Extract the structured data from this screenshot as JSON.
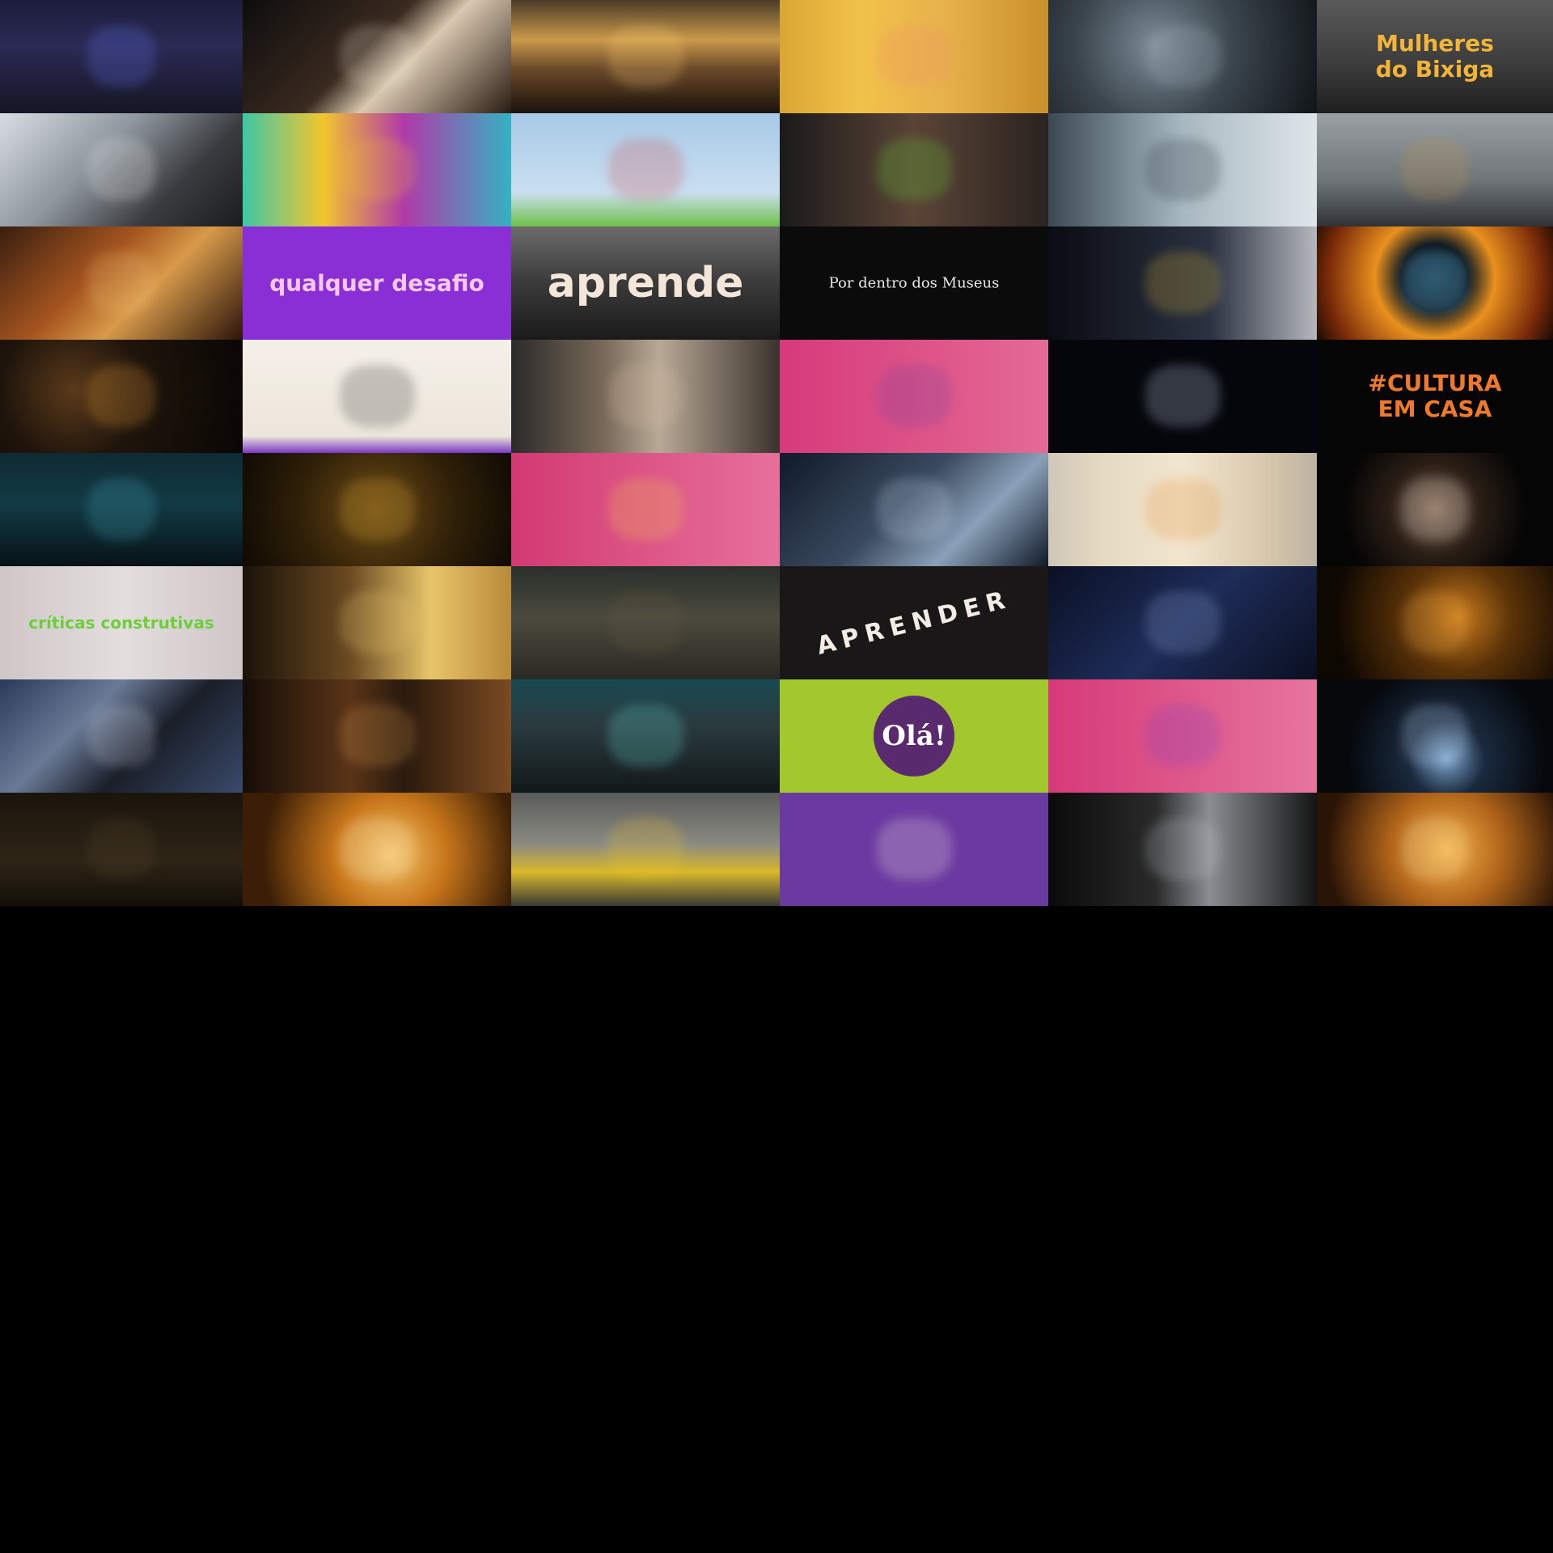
{
  "gallery": {
    "columns": [
      300,
      332,
      332,
      332,
      332,
      292
    ],
    "rows": [
      [
        {
          "id": "t1",
          "name": "thumb-conference-audience",
          "bg": "linear-gradient(180deg,#1b1d3a 0%,#2b2a55 40%,#151523 100%)",
          "accent": "#6b7cff",
          "caption": ""
        },
        {
          "id": "t2",
          "name": "thumb-orchestra-flute",
          "bg": "linear-gradient(135deg,#0d0d0d 0%,#3a2a20 45%,#d8c8b0 60%,#2a1b12 100%)",
          "accent": "#f0e6d6",
          "caption": ""
        },
        {
          "id": "t3",
          "name": "thumb-sunset-plane",
          "bg": "linear-gradient(180deg,#4a3a28 0%,#c99a4a 35%,#6d4a2a 60%,#1a130c 100%)",
          "accent": "#ffd27a",
          "caption": ""
        },
        {
          "id": "t4",
          "name": "thumb-yellow-alley-parade",
          "bg": "linear-gradient(90deg,#d9a634 0%,#f1c24a 30%,#e8b24c 60%,#c98f2a 100%)",
          "accent": "#f08a6a",
          "caption": ""
        },
        {
          "id": "t5",
          "name": "thumb-alien-face",
          "bg": "radial-gradient(circle at 40% 40%,#7c8b95 0%,#3b454d 45%,#101417 100%)",
          "accent": "#a8b6c0",
          "caption": ""
        },
        {
          "id": "t6",
          "name": "thumb-mulheres-do-bixiga",
          "bg": "linear-gradient(180deg,#5a5a5a 0%,#3a3a3a 60%,#1e1e1e 100%)",
          "accent": "#f2b53a",
          "caption": "Mulheres\ndo Bixiga"
        }
      ],
      [
        {
          "id": "t7",
          "name": "thumb-plane-cockpit-couple",
          "bg": "linear-gradient(135deg,#d8dde2 0%,#8e969d 40%,#3a3c40 70%,#1c1c1f 100%)",
          "accent": "#f2f2f2",
          "caption": ""
        },
        {
          "id": "t8",
          "name": "thumb-virada-online",
          "bg": "linear-gradient(90deg,#3ec7a6 0%,#f3c52d 30%,#b13aa8 60%,#34b2c3 100%)",
          "accent": "#f3c52d",
          "caption": ""
        },
        {
          "id": "t9",
          "name": "thumb-cartoon-barn",
          "bg": "linear-gradient(180deg,#a7c9e6 0%,#c9dff0 70%,#6fbf4a 100%)",
          "accent": "#d23b3b",
          "caption": ""
        },
        {
          "id": "t10",
          "name": "thumb-treinar-eye",
          "bg": "linear-gradient(90deg,#1a1a1a 0%,#5a4436 50%,#2a2320 100%)",
          "accent": "#6bdc3a",
          "caption": ""
        },
        {
          "id": "t11",
          "name": "thumb-man-drinking-lab",
          "bg": "linear-gradient(90deg,#3b4a52 0%,#a8b8c0 50%,#dfe6ea 100%)",
          "accent": "#1b2730",
          "caption": ""
        },
        {
          "id": "t12",
          "name": "thumb-astronaut-gold-visor",
          "bg": "linear-gradient(180deg,#9aa0a4 0%,#6e7478 60%,#2f3336 100%)",
          "accent": "#c59b4a",
          "caption": ""
        }
      ],
      [
        {
          "id": "t13",
          "name": "thumb-pouring-drink",
          "bg": "linear-gradient(135deg,#3a1e10 0%,#a6561f 40%,#d89a4a 60%,#2a140a 100%)",
          "accent": "#f1c27a",
          "caption": ""
        },
        {
          "id": "t14",
          "name": "thumb-qualquer-desafio",
          "bg": "#8a2fd6",
          "accent": "#f3c9e6",
          "caption": "qualquer desafio"
        },
        {
          "id": "t15",
          "name": "thumb-aprende",
          "bg": "linear-gradient(180deg,#6b6b6b 0%,#3a3a3a 50%,#1a1a1a 100%)",
          "accent": "#f4e6d8",
          "caption": "aprende"
        },
        {
          "id": "t16",
          "name": "thumb-por-dentro-dos-museus",
          "bg": "#0b0b0b",
          "accent": "#e8e8e8",
          "caption": "Por dentro dos Museus"
        },
        {
          "id": "t17",
          "name": "thumb-bottle-glove",
          "bg": "linear-gradient(90deg,#0a0c12 0%,#2a3140 60%,#b5b8bd 100%)",
          "accent": "#e8c13a",
          "caption": ""
        },
        {
          "id": "t18",
          "name": "thumb-fire-sphere",
          "bg": "radial-gradient(circle at 50% 45%,#1d3a4a 0%,#0f1a22 25%,#e8901e 45%,#7a2a08 80%,#1a0a04 100%)",
          "accent": "#6fd0ff",
          "caption": ""
        }
      ],
      [
        {
          "id": "t19",
          "name": "thumb-dark-tunnel",
          "bg": "radial-gradient(circle at 30% 45%,#5a3a1a 0%,#1e140b 40%,#090604 100%)",
          "accent": "#f3a33a",
          "caption": ""
        },
        {
          "id": "t20",
          "name": "thumb-masked-face-sketch",
          "bg": "linear-gradient(180deg,#f5f0e8 0%,#ece6dc 85%,#7a3ac2 100%)",
          "accent": "#222222",
          "caption": ""
        },
        {
          "id": "t21",
          "name": "thumb-man-office",
          "bg": "linear-gradient(90deg,#2a2a2a 0%,#7a6a5a 35%,#b8a896 55%,#3a332d 100%)",
          "accent": "#d8c4a8",
          "caption": ""
        },
        {
          "id": "t22",
          "name": "thumb-teamwork-illustration",
          "bg": "linear-gradient(90deg,#d63a7a 0%,#e46a94 100%)",
          "accent": "#6b3fa0",
          "caption": ""
        },
        {
          "id": "t23",
          "name": "thumb-neon-bottle",
          "bg": "#05060c",
          "accent": "#d8e8ff",
          "caption": ""
        },
        {
          "id": "t24",
          "name": "thumb-cultura-em-casa",
          "bg": "#050505",
          "accent": "#f07a2a",
          "caption": "#CULTURA\nEM CASA"
        }
      ],
      [
        {
          "id": "t25",
          "name": "thumb-city-night-figures",
          "bg": "linear-gradient(180deg,#0f2a33 0%,#123a44 45%,#071216 100%)",
          "accent": "#4bb3c7",
          "caption": ""
        },
        {
          "id": "t26",
          "name": "thumb-bottle-gold-particles",
          "bg": "radial-gradient(circle at 50% 50%,#6b4a14 0%,#2e1f08 55%,#0e0a03 100%)",
          "accent": "#e7b23a",
          "caption": ""
        },
        {
          "id": "t27",
          "name": "thumb-lightbulb-idea",
          "bg": "linear-gradient(90deg,#d23a72 0%,#e6709a 100%)",
          "accent": "#f6d44a",
          "caption": ""
        },
        {
          "id": "t28",
          "name": "thumb-pilot-helmet",
          "bg": "linear-gradient(135deg,#0f1a2a 0%,#3a4a5e 45%,#8aa0b8 70%,#101a28 100%)",
          "accent": "#cfe0f2",
          "caption": ""
        },
        {
          "id": "t29",
          "name": "thumb-wall-mural-figure",
          "bg": "linear-gradient(90deg,#cfc7b8 0%,#e6d9c2 20%,#f2e6cf 50%,#d9c8ac 80%,#bdb3a3 100%)",
          "accent": "#e48a2a",
          "caption": ""
        },
        {
          "id": "t30",
          "name": "thumb-screaming-man",
          "bg": "radial-gradient(circle at 50% 50%,#8a6a52 0%,#2a1e16 35%,#050505 70%)",
          "accent": "#dcdcdc",
          "caption": ""
        }
      ],
      [
        {
          "id": "t31",
          "name": "thumb-criticas-construtivas",
          "bg": "linear-gradient(90deg,#cfc7c7 0%,#e4dddd 50%,#cfc7c7 100%)",
          "accent": "#6ccf3a",
          "caption": "críticas construtivas"
        },
        {
          "id": "t32",
          "name": "thumb-glasses-woman-gold",
          "bg": "linear-gradient(90deg,#1a1209 0%,#6a4a22 40%,#e8c56a 70%,#b88a3a 100%)",
          "accent": "#f3d27a",
          "caption": ""
        },
        {
          "id": "t33",
          "name": "thumb-potato-rock",
          "bg": "linear-gradient(180deg,#2a2f2a 0%,#4a4a3e 45%,#2a2a24 100%)",
          "accent": "#6a5a44",
          "caption": ""
        },
        {
          "id": "t34",
          "name": "thumb-aprender-letters",
          "bg": "#1a1718",
          "accent": "#f3ece4",
          "caption": "APRENDER"
        },
        {
          "id": "t35",
          "name": "thumb-astronaut-cockpit-blue",
          "bg": "linear-gradient(135deg,#0a1024 0%,#1e2c58 50%,#0a0f20 100%)",
          "accent": "#9ab0e0",
          "caption": ""
        },
        {
          "id": "t36",
          "name": "thumb-bottle-amber-glow",
          "bg": "radial-gradient(circle at 60% 45%,#c87a1e 0%,#5a3208 35%,#0e0803 80%)",
          "accent": "#f4b14a",
          "caption": ""
        }
      ],
      [
        {
          "id": "t37",
          "name": "thumb-astronaut-spacewalk",
          "bg": "linear-gradient(135deg,#2a3a5a 0%,#6a7a96 35%,#1a1e28 60%,#3a4a6a 100%)",
          "accent": "#d0d8e8",
          "caption": ""
        },
        {
          "id": "t38",
          "name": "thumb-singer-band",
          "bg": "linear-gradient(90deg,#140c06 0%,#5a3418 40%,#2a1a0e 60%,#7a4a22 100%)",
          "accent": "#e0a050",
          "caption": ""
        },
        {
          "id": "t39",
          "name": "thumb-man-teal-lights",
          "bg": "linear-gradient(180deg,#1a4a52 0%,#2a3a3e 40%,#121819 100%)",
          "accent": "#6ee8e0",
          "caption": ""
        },
        {
          "id": "t40",
          "name": "thumb-ola-circle",
          "bg": "#a3c82e",
          "accent": "#5a2a6e",
          "caption": "Olá!"
        },
        {
          "id": "t41",
          "name": "thumb-laptop-chat-illustration",
          "bg": "linear-gradient(90deg,#d63a78 0%,#e6759c 100%)",
          "accent": "#7a3ac2",
          "caption": ""
        },
        {
          "id": "t42",
          "name": "thumb-bottle-blue-beam",
          "bg": "radial-gradient(circle at 55% 70%,#7aa0c8 0%,#1a2a3e 25%,#06080c 65%)",
          "accent": "#cfe6ff",
          "caption": ""
        }
      ],
      [
        {
          "id": "t43",
          "name": "thumb-dark-cave-ground",
          "bg": "linear-gradient(180deg,#1a140c 0%,#2e2416 60%,#120e08 100%)",
          "accent": "#5a4a32",
          "caption": ""
        },
        {
          "id": "t44",
          "name": "thumb-bottle-flame-tunnel",
          "bg": "radial-gradient(circle at 55% 55%,#f3c46a 0%,#c8761a 35%,#3a1e06 80%)",
          "accent": "#fff0c8",
          "caption": ""
        },
        {
          "id": "t45",
          "name": "thumb-yellow-bridge-trees",
          "bg": "linear-gradient(180deg,#5a5a5a 0%,#8a8a82 45%,#d8b82a 70%,#3a3a36 100%)",
          "accent": "#f0c62a",
          "caption": ""
        },
        {
          "id": "t46",
          "name": "thumb-poll-results-card",
          "bg": "#6b3aa0",
          "accent": "#fbf5e6",
          "caption": ""
        },
        {
          "id": "t47",
          "name": "thumb-robot-suit-city",
          "bg": "linear-gradient(90deg,#0a0a0a 0%,#2a2a2a 40%,#8a8e92 60%,#141414 100%)",
          "accent": "#c8ccd0",
          "caption": ""
        },
        {
          "id": "t48",
          "name": "thumb-bottle-amber-closeup",
          "bg": "radial-gradient(circle at 55% 50%,#f4b24a 0%,#b0641a 40%,#2a1406 85%)",
          "accent": "#fde6b0",
          "caption": ""
        }
      ]
    ]
  }
}
